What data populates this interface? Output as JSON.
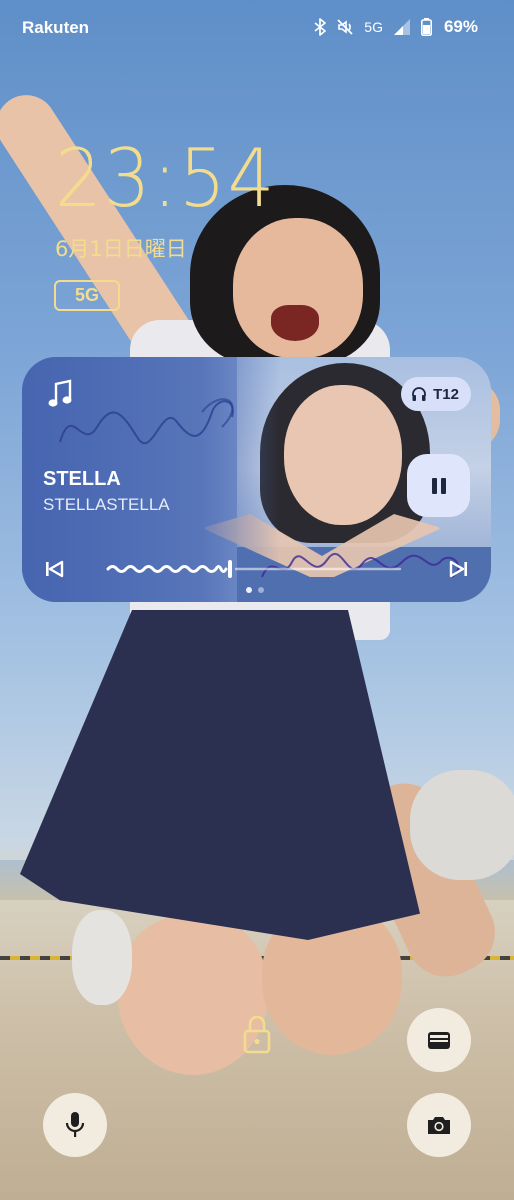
{
  "status_bar": {
    "carrier": "Rakuten",
    "network": "5G",
    "battery_percent": "69%",
    "icons": [
      "bluetooth-icon",
      "mute-icon",
      "signal-icon",
      "battery-icon"
    ]
  },
  "lock_screen": {
    "time": "23:54",
    "date": "6月1日日曜日",
    "network_badge": "5G",
    "accent_color": "#f3dc8e"
  },
  "media_player": {
    "title": "STELLA",
    "artist": "STELLASTELLA",
    "output_device": "T12",
    "state": "playing",
    "progress": 0.42,
    "page_indicator": {
      "count": 2,
      "active": 0
    },
    "icons": [
      "music-note-icon",
      "headphones-icon",
      "pause-icon",
      "previous-icon",
      "next-icon"
    ]
  },
  "shortcuts": {
    "icons": [
      "lock-icon",
      "wallet-icon",
      "mic-icon",
      "camera-icon"
    ]
  }
}
